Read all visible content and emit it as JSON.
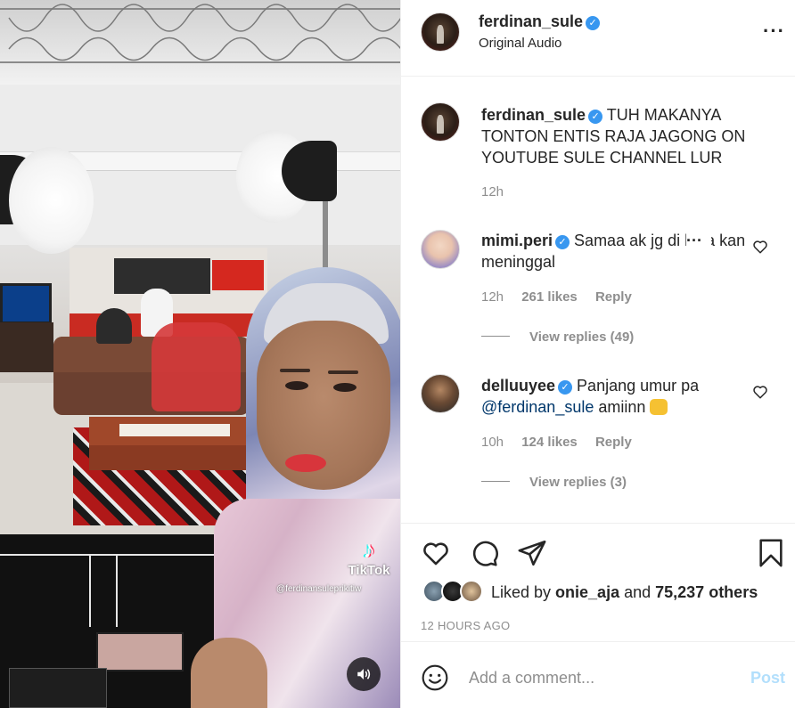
{
  "media": {
    "tiktok_word": "TikTok",
    "tiktok_note": "♪",
    "tiktok_handle": "@ferdinansuleprikitiw",
    "sound_icon": "speaker-icon"
  },
  "header": {
    "username": "ferdinan_sule",
    "verified_mark": "✓",
    "subtitle": "Original Audio",
    "more": "···"
  },
  "caption": {
    "username": "ferdinan_sule",
    "verified_mark": "✓",
    "text": "TUH MAKANYA TONTON ENTIS RAJA JAGONG ON YOUTUBE SULE CHANNEL LUR",
    "time": "12h"
  },
  "comments": [
    {
      "username": "mimi.peri",
      "verified_mark": "✓",
      "text": "Samaa ak jg di bela kan meninggal",
      "overlay": "···",
      "time": "12h",
      "likes": "261 likes",
      "reply": "Reply",
      "view_replies": "View replies (49)"
    },
    {
      "username": "delluuyee",
      "verified_mark": "✓",
      "text": "Panjang umur pa",
      "mention": "@ferdinan_sule",
      "text_after": " amiinn",
      "time": "10h",
      "likes": "124 likes",
      "reply": "Reply",
      "view_replies": "View replies (3)"
    }
  ],
  "actions": {
    "liked_prefix": "Liked by ",
    "liked_user": "onie_aja",
    "liked_and": " and ",
    "liked_others": "75,237 others",
    "timestamp": "12 HOURS AGO"
  },
  "add_comment": {
    "placeholder": "Add a comment...",
    "post_label": "Post"
  },
  "colors": {
    "verified": "#3897f0",
    "mention": "#00376b",
    "post_disabled": "#b2dffc",
    "secondary_text": "#8e8e8e"
  }
}
